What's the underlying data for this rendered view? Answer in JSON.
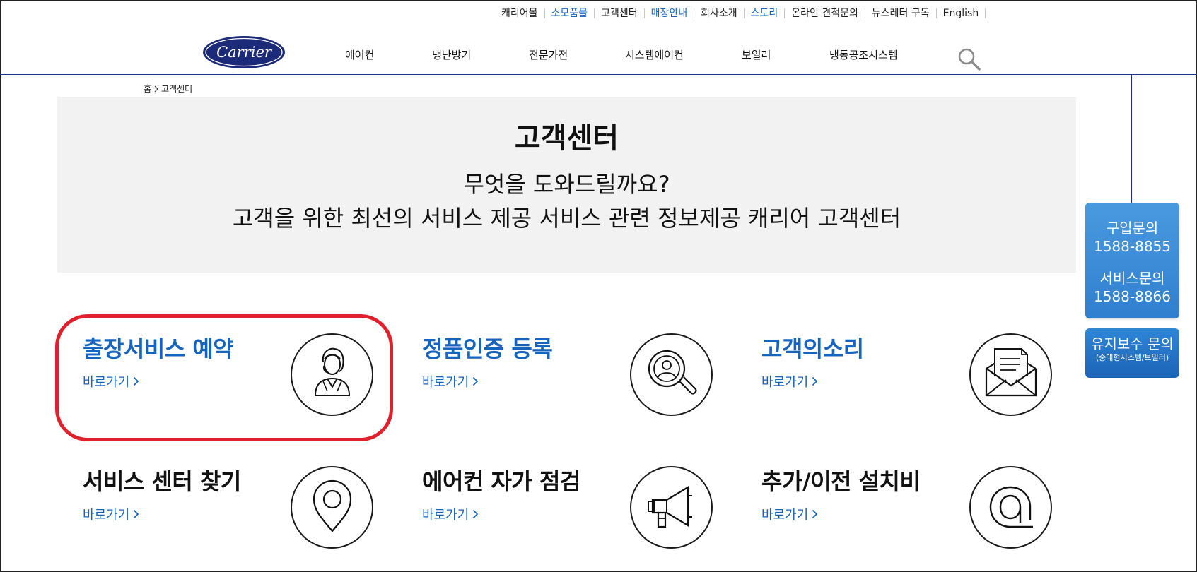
{
  "utility_nav": [
    {
      "label": "캐리어몰",
      "color": "#222222"
    },
    {
      "label": "소모품몰",
      "color": "#1565c0"
    },
    {
      "label": "고객센터",
      "color": "#222222"
    },
    {
      "label": "매장안내",
      "color": "#1565c0"
    },
    {
      "label": "회사소개",
      "color": "#222222"
    },
    {
      "label": "스토리",
      "color": "#1565c0"
    },
    {
      "label": "온라인 견적문의",
      "color": "#222222"
    },
    {
      "label": "뉴스레터 구독",
      "color": "#222222"
    },
    {
      "label": "English",
      "color": "#222222"
    }
  ],
  "logo": {
    "text": "Carrier"
  },
  "main_nav": [
    "에어컨",
    "냉난방기",
    "전문가전",
    "시스템에어컨",
    "보일러",
    "냉동공조시스템"
  ],
  "breadcrumb": {
    "home": "홈",
    "current": "고객센터"
  },
  "banner": {
    "title": "고객센터",
    "subtitle1": "무엇을 도와드릴까요?",
    "subtitle2": "고객을 위한 최선의 서비스 제공 서비스 관련 정보제공 캐리어 고객센터"
  },
  "quick": {
    "purchase_label": "구입문의",
    "purchase_phone": "1588-8855",
    "service_label": "서비스문의",
    "service_phone": "1588-8866",
    "maint_label": "유지보수 문의",
    "maint_sub": "(중대형시스템/보일러)"
  },
  "cards": [
    {
      "title": "출장서비스 예약",
      "link": "바로가기",
      "icon": "customer-agent-icon"
    },
    {
      "title": "정품인증 등록",
      "link": "바로가기",
      "icon": "magnifier-person-icon"
    },
    {
      "title": "고객의소리",
      "link": "바로가기",
      "icon": "envelope-letter-icon"
    },
    {
      "title": "서비스 센터 찾기",
      "link": "바로가기",
      "icon": "map-pin-icon"
    },
    {
      "title": "에어컨 자가 점검",
      "link": "바로가기",
      "icon": "megaphone-icon"
    },
    {
      "title": "추가/이전 설치비",
      "link": "바로가기",
      "icon": "at-sign-icon"
    }
  ],
  "colors": {
    "accent": "#1565c0",
    "highlight": "#e0202c",
    "banner_bg": "#f2f2f2",
    "header_line": "#1b2f8a"
  }
}
